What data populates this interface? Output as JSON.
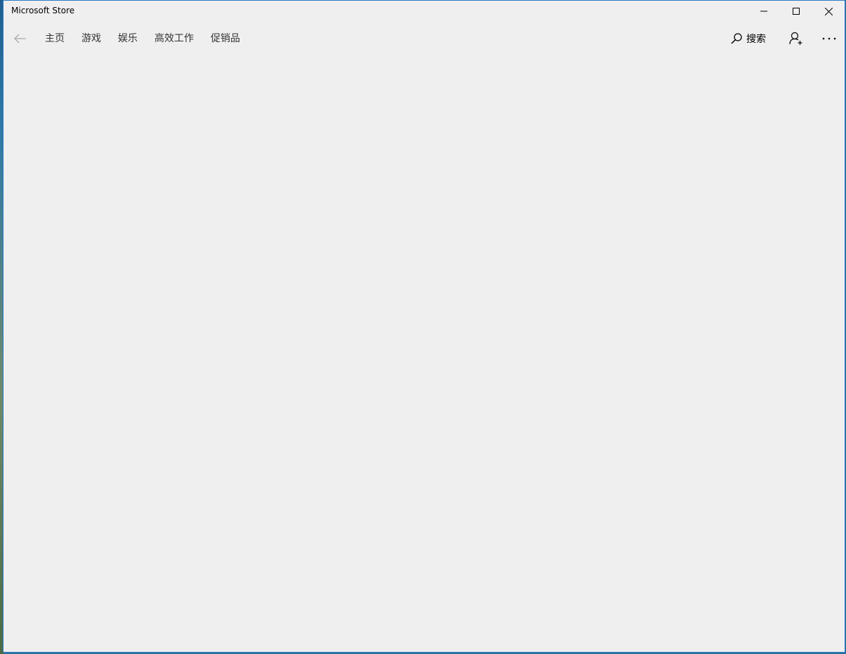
{
  "window": {
    "title": "Microsoft Store"
  },
  "caption_buttons": {
    "minimize": "minimize-icon",
    "maximize": "maximize-icon",
    "close": "close-icon"
  },
  "nav": {
    "back_icon": "back-arrow-icon",
    "tabs": [
      {
        "label": "主页"
      },
      {
        "label": "游戏"
      },
      {
        "label": "娱乐"
      },
      {
        "label": "高效工作"
      },
      {
        "label": "促销品"
      }
    ],
    "search": {
      "icon": "search-icon",
      "label": "搜索"
    },
    "account_icon": "add-user-icon",
    "more_icon": "more-icon"
  },
  "colors": {
    "window_border": "#2b79c2",
    "background": "#f0efef"
  }
}
